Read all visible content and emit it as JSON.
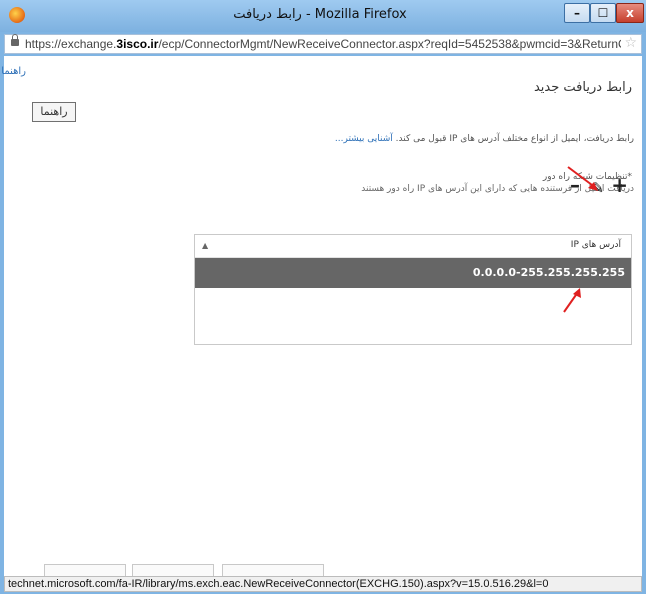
{
  "window": {
    "title": "Mozilla Firefox - رابط دریافت",
    "min_label": "–",
    "max_label": "☐",
    "close_label": "x"
  },
  "addressbar": {
    "url_prefix": "https://exchange.",
    "url_domain": "3isco.ir",
    "url_rest": "/ecp/ConnectorMgmt/NewReceiveConnector.aspx?reqId=5452538&pwmcid=3&ReturnObjectTy",
    "star_glyph": "☆"
  },
  "page": {
    "help_link": "راهنما",
    "title": "رابط دریافت جدید",
    "help_button": "راهنما",
    "description": "رابط دریافت، ایمیل از انواع مختلف آدرس های IP قبول می کند. آشنایی بیشتر...",
    "learn_more": "آشنایی بیشتر...",
    "section_label": "*تنظیمات شبکه راه دور",
    "section_desc": "دریافت ایمیل از فرستنده هایی که دارای این آدرس های IP راه دور هستند"
  },
  "toolbar": {
    "add": "+",
    "edit": "✎",
    "remove": "–"
  },
  "grid": {
    "column_header": "آدرس های IP",
    "sort_glyph": "▲",
    "rows": [
      {
        "value": "0.0.0.0-255.255.255.255"
      }
    ]
  },
  "statusbar": {
    "text": "technet.microsoft.com/fa-IR/library/ms.exch.eac.NewReceiveConnector(EXCHG.150).aspx?v=15.0.516.29&l=0"
  },
  "colors": {
    "titlebar": "#7fb4e3",
    "selected_row": "#666666",
    "annotation_arrow": "#e02020",
    "link": "#2c6fb7"
  }
}
